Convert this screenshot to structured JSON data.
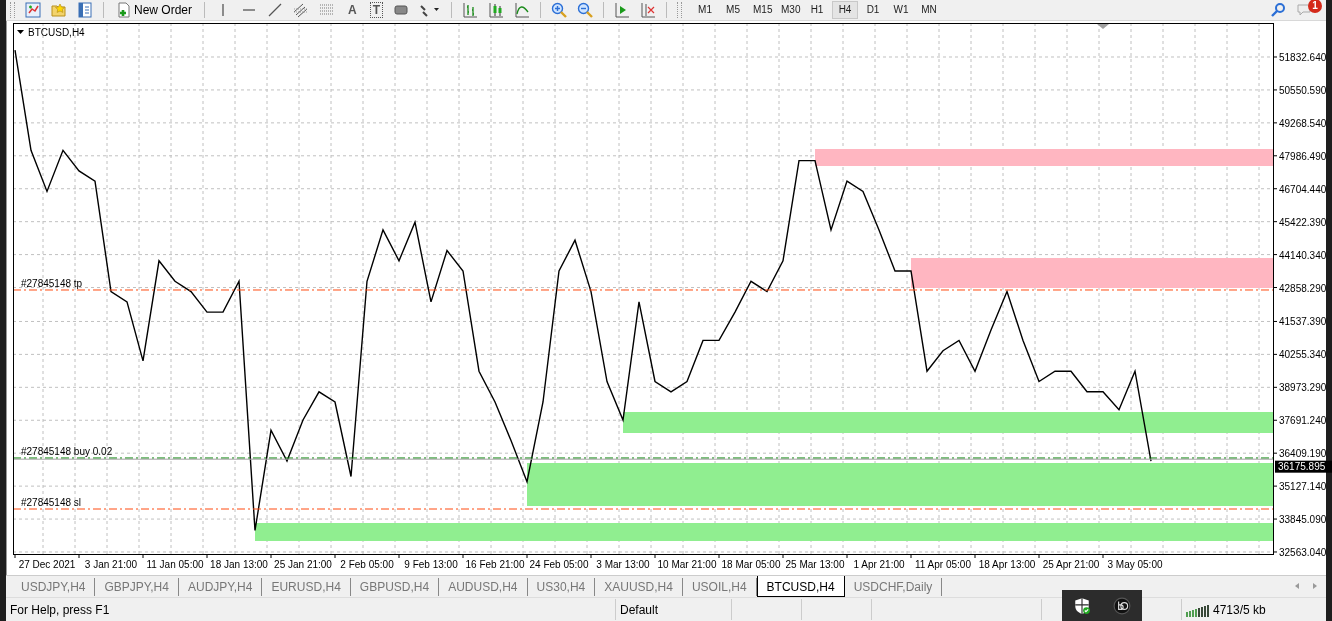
{
  "toolbar": {
    "new_order": "New Order",
    "text_tool": "A",
    "text_label_tool": "T",
    "timeframes": [
      {
        "label": "M1",
        "selected": false
      },
      {
        "label": "M5",
        "selected": false
      },
      {
        "label": "M15",
        "selected": false
      },
      {
        "label": "M30",
        "selected": false
      },
      {
        "label": "H1",
        "selected": false
      },
      {
        "label": "H4",
        "selected": true
      },
      {
        "label": "D1",
        "selected": false
      },
      {
        "label": "W1",
        "selected": false
      },
      {
        "label": "MN",
        "selected": false
      }
    ],
    "notification_count": "1"
  },
  "chart": {
    "chart_data": {
      "type": "line",
      "title": "BTCUSD,H4",
      "grid": true,
      "ylim": [
        32484.4,
        53156.26
      ],
      "categories": [
        null,
        null,
        "27 Dec 2021",
        null,
        null,
        null,
        "3 Jan 21:00",
        null,
        null,
        null,
        "11 Jan 05:00",
        null,
        null,
        null,
        "18 Jan 13:00",
        null,
        null,
        null,
        "25 Jan 21:00",
        null,
        null,
        null,
        "2 Feb 05:00",
        null,
        null,
        null,
        "9 Feb 13:00",
        null,
        null,
        null,
        "16 Feb 21:00",
        null,
        null,
        null,
        "24 Feb 05:00",
        null,
        null,
        null,
        "3 Mar 13:00",
        null,
        null,
        null,
        "10 Mar 21:00",
        null,
        null,
        null,
        "18 Mar 05:00",
        null,
        null,
        null,
        "25 Mar 13:00",
        null,
        null,
        null,
        "1 Apr 21:00",
        null,
        null,
        null,
        "11 Apr 05:00",
        null,
        null,
        null,
        "18 Apr 13:00",
        null,
        null,
        null,
        "25 Apr 21:00",
        null,
        null,
        null,
        "3 May 05:00",
        null
      ],
      "series": [
        {
          "color": "#000000",
          "values": [
            52100,
            48200,
            46600,
            48200,
            47400,
            47000,
            42700,
            42300,
            40000,
            43900,
            43100,
            42700,
            41900,
            41900,
            43100,
            33400,
            37300,
            36100,
            37700,
            38800,
            38400,
            35500,
            43100,
            45100,
            43900,
            45400,
            42300,
            44300,
            43500,
            39600,
            38400,
            36900,
            35300,
            38400,
            43500,
            44700,
            42700,
            39200,
            37700,
            42300,
            39200,
            38800,
            39200,
            40800,
            40800,
            41900,
            43100,
            42700,
            43900,
            47800,
            47800,
            45100,
            47000,
            46600,
            45100,
            43500,
            43500,
            39600,
            40400,
            40800,
            39600,
            41200,
            42700,
            40800,
            39200,
            39600,
            39600,
            38800,
            38800,
            38100,
            39600,
            36100
          ]
        }
      ],
      "yticks": [
        {
          "value": 51832.64,
          "label": "51832.640"
        },
        {
          "value": 50550.59,
          "label": "50550.590"
        },
        {
          "value": 49268.54,
          "label": "49268.540"
        },
        {
          "value": 47986.49,
          "label": "47986.490"
        },
        {
          "value": 46704.44,
          "label": "46704.440"
        },
        {
          "value": 45422.39,
          "label": "45422.390"
        },
        {
          "value": 44140.34,
          "label": "44140.340"
        },
        {
          "value": 42858.29,
          "label": "42858.290"
        },
        {
          "value": 41537.39,
          "label": "41537.390"
        },
        {
          "value": 40255.34,
          "label": "40255.340"
        },
        {
          "value": 38973.29,
          "label": "38973.290"
        },
        {
          "value": 37691.24,
          "label": "37691.240"
        },
        {
          "value": 36409.19,
          "label": "36409.190"
        },
        {
          "value": 35127.14,
          "label": "35127.140"
        },
        {
          "value": 33845.09,
          "label": "33845.090"
        },
        {
          "value": 32563.04,
          "label": "32563.040"
        }
      ],
      "bands": [
        {
          "axis": "y",
          "from": 47589,
          "to": 48251,
          "color": "#ffb6c1"
        },
        {
          "axis": "y",
          "from": 42840,
          "to": 44008,
          "color": "#ffb6c1"
        },
        {
          "axis": "y",
          "from": 37195,
          "to": 38013,
          "color": "#90ee90"
        },
        {
          "axis": "y",
          "from": 34353,
          "to": 36027,
          "color": "#90ee90"
        },
        {
          "axis": "y",
          "from": 32991,
          "to": 33691,
          "color": "#90ee90"
        }
      ],
      "ref_lines": [
        {
          "axis": "y",
          "color": "#ff4a10",
          "value": 42762,
          "label": "#27845148 tp"
        },
        {
          "axis": "y",
          "color": "#008000",
          "value": 36222,
          "label": "#27845148 buy 0.02"
        },
        {
          "axis": "y",
          "color": "#ff4a10",
          "value": 34236,
          "label": "#27845148 sl"
        },
        {
          "axis": "y",
          "color": "#a0a0a0",
          "value": 36175.895
        }
      ],
      "annotations": [
        "36175.895"
      ]
    }
  },
  "tabs": [
    {
      "label": "USDJPY,H4",
      "selected": false
    },
    {
      "label": "GBPJPY,H4",
      "selected": false
    },
    {
      "label": "AUDJPY,H4",
      "selected": false
    },
    {
      "label": "EURUSD,H4",
      "selected": false
    },
    {
      "label": "GBPUSD,H4",
      "selected": false
    },
    {
      "label": "AUDUSD,H4",
      "selected": false
    },
    {
      "label": "US30,H4",
      "selected": false
    },
    {
      "label": "XAUUSD,H4",
      "selected": false
    },
    {
      "label": "USOIL,H4",
      "selected": false
    },
    {
      "label": "BTCUSD,H4",
      "selected": true
    },
    {
      "label": "USDCHF,Daily",
      "selected": false
    }
  ],
  "status_bar": {
    "help": "For Help, press F1",
    "profile": "Default",
    "traffic": "4713/5 kb"
  }
}
